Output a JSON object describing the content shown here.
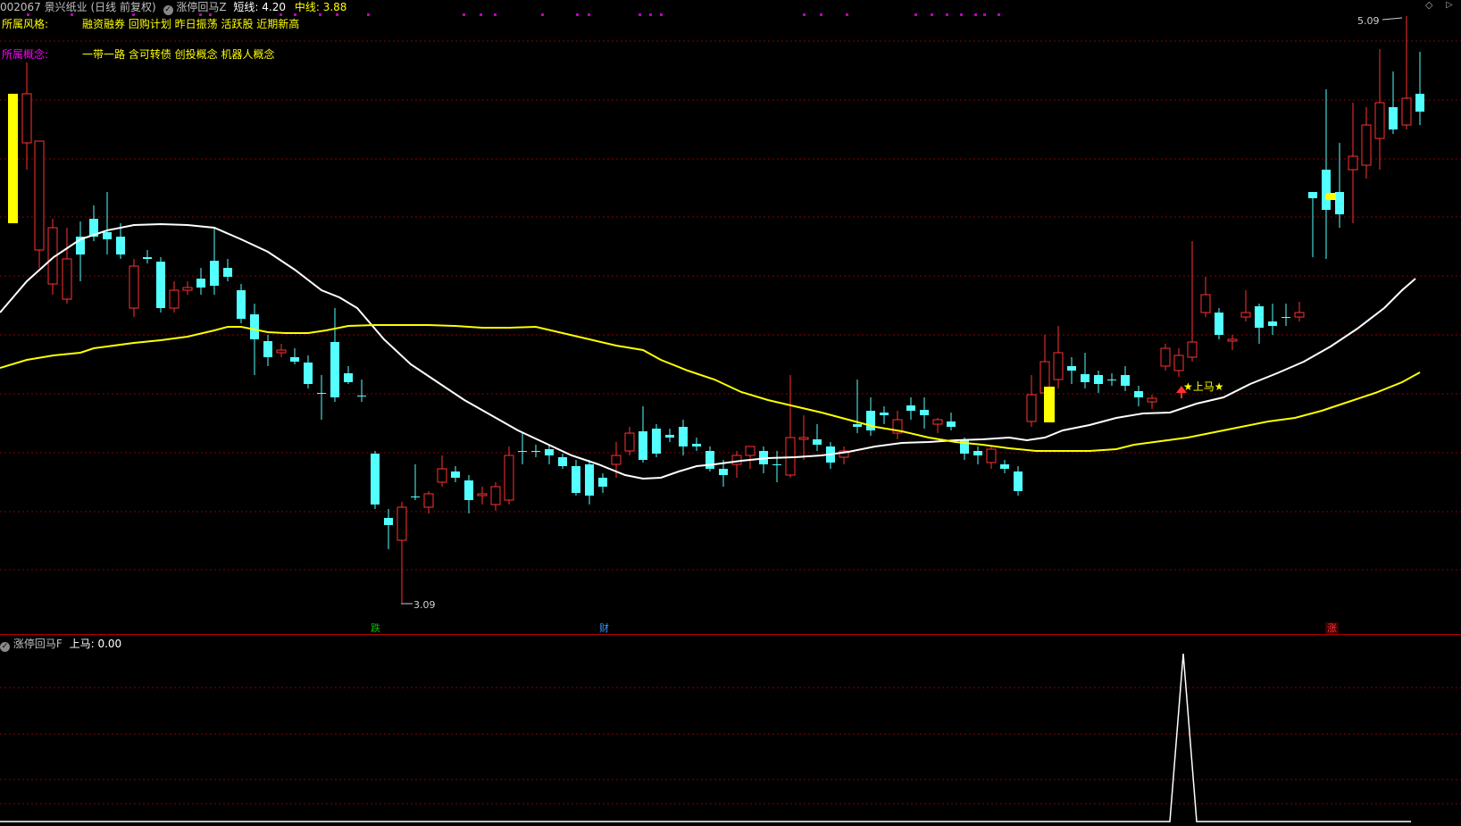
{
  "header": {
    "stock_code": "002067",
    "stock_name": "景兴纸业",
    "period": "(日线 前复权)",
    "indicator_name": "涨停回马Z",
    "short_label": "短线:",
    "short_value": "4.20",
    "mid_label": "中线:",
    "mid_value": "3.88"
  },
  "info": {
    "style_label": "所属风格:",
    "style_value": "融资融券 回购计划 昨日振荡 活跃股 近期新高",
    "concept_label": "所属概念:",
    "concept_value": "一带一路 含可转债 创投概念 机器人概念"
  },
  "annotations": {
    "high_label": "5.09",
    "low_label": "3.09",
    "signal_label": "★上马★"
  },
  "bottom_markers": [
    {
      "text": "跌",
      "color": "#00c000"
    },
    {
      "text": "财",
      "color": "#3399ff"
    },
    {
      "text": "涨",
      "color": "#ff3030"
    }
  ],
  "sub": {
    "indicator_name": "涨停回马F",
    "value_label": "上马:",
    "value": "0.00"
  },
  "colors": {
    "up": "#ff3232",
    "down": "#54ffff",
    "short_line": "#ffffff",
    "mid_line": "#ffff00",
    "grid": "#8a0000",
    "header_yellow": "#ffff00",
    "concept_magenta": "#ff00ff"
  },
  "chart_data": {
    "type": "candlestick",
    "y_unit": "price",
    "price_high": 5.09,
    "price_low": 3.09,
    "series": [
      {
        "name": "短线",
        "value": 4.2
      },
      {
        "name": "中线",
        "value": 3.88
      }
    ],
    "signal_value": 0.0
  }
}
